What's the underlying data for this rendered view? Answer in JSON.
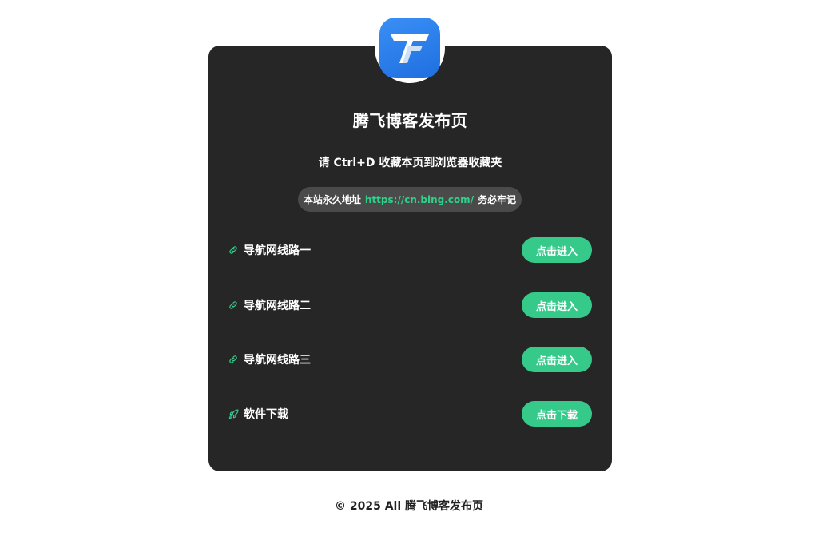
{
  "header": {
    "title": "腾飞博客发布页",
    "subtitle": "请 Ctrl+D 收藏本页到浏览器收藏夹",
    "permanent_prefix": "本站永久地址",
    "permanent_url": "https://cn.bing.com/",
    "permanent_suffix": "务必牢记"
  },
  "links": [
    {
      "label": "导航网线路一",
      "button": "点击进入",
      "icon": "link-icon"
    },
    {
      "label": "导航网线路二",
      "button": "点击进入",
      "icon": "link-icon"
    },
    {
      "label": "导航网线路三",
      "button": "点击进入",
      "icon": "link-icon"
    },
    {
      "label": "软件下载",
      "button": "点击下载",
      "icon": "rocket-icon"
    }
  ],
  "footer": {
    "copyright": "© 2025 All 腾飞博客发布页"
  },
  "colors": {
    "card_bg": "#262626",
    "accent_green": "#35c98a",
    "url_green": "#2ed18a",
    "logo_blue": "#2a7fee"
  }
}
